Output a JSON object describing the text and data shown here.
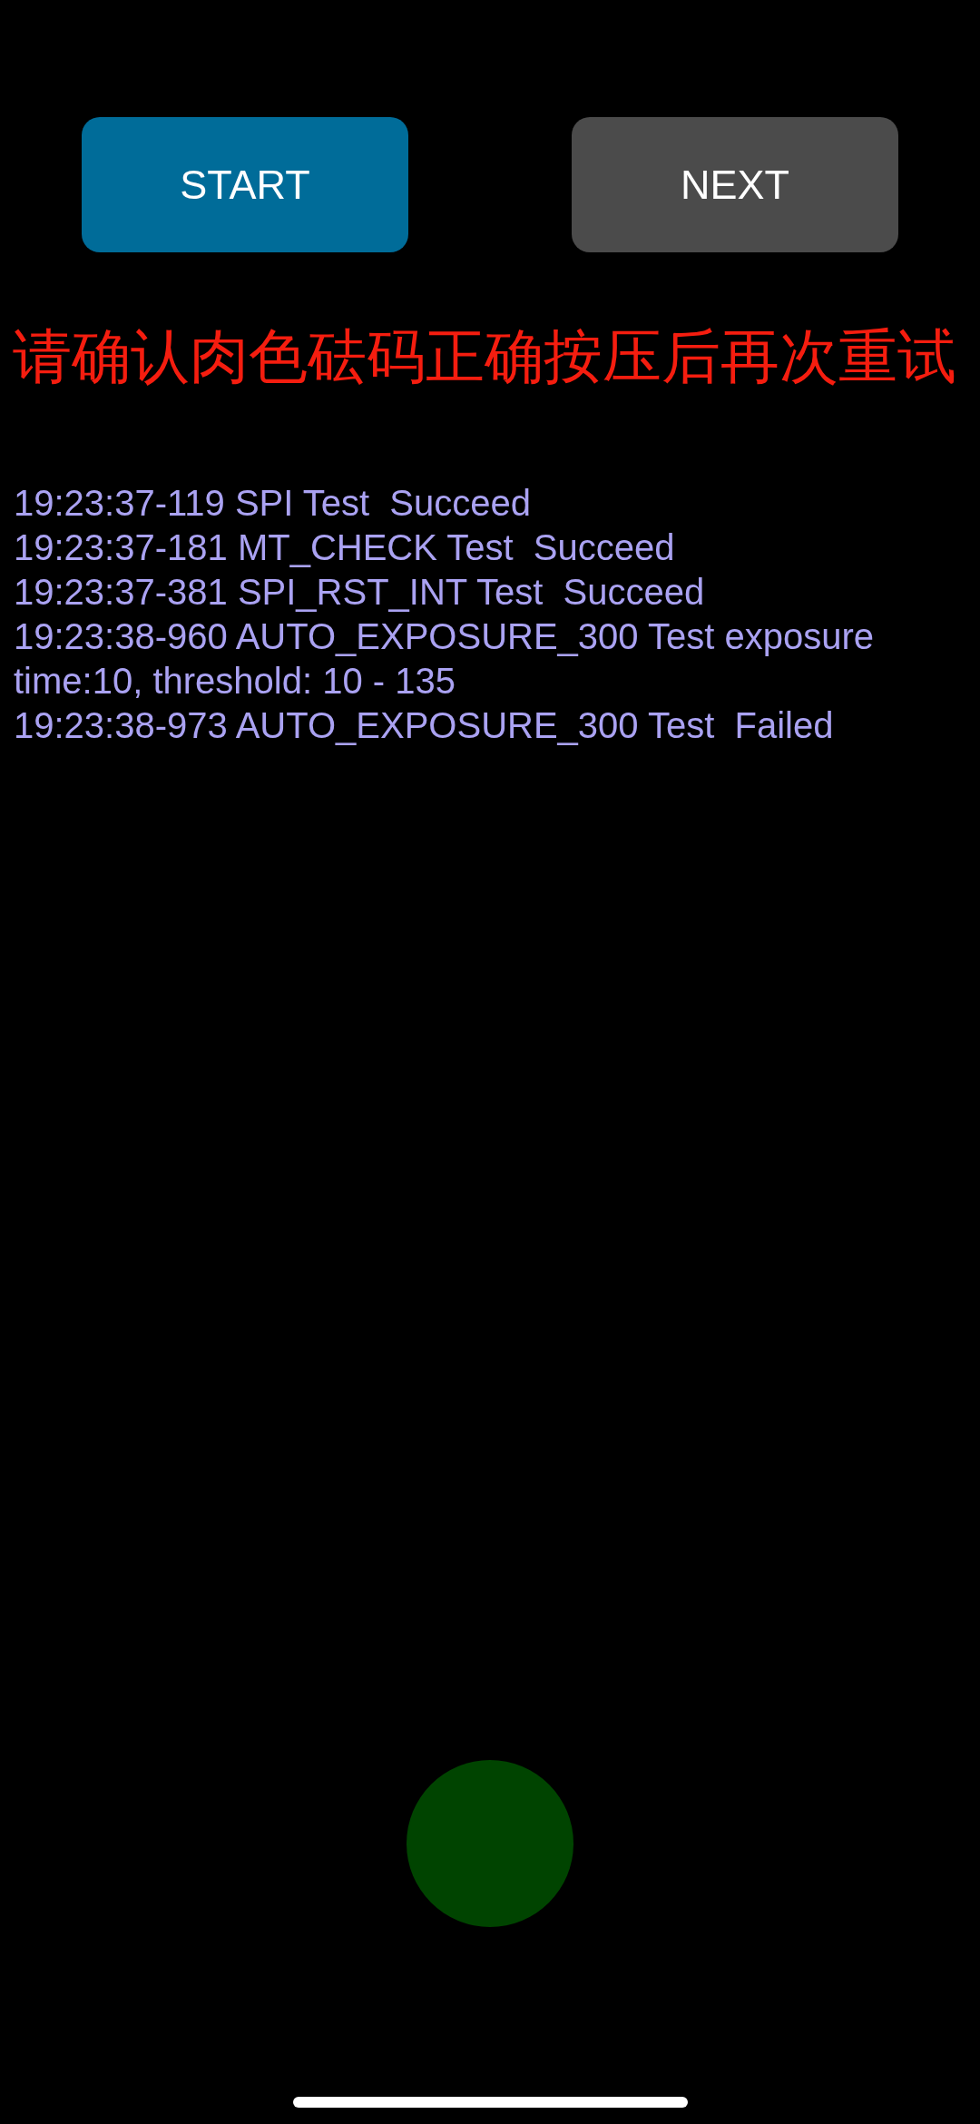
{
  "buttons": [
    {
      "label": "START",
      "color": "#006c99"
    },
    {
      "label": "NEXT",
      "color": "#4b4b4b"
    }
  ],
  "warning": "请确认肉色砝码正确按压后再次重试",
  "log": [
    "19:23:37-119 SPI Test  Succeed",
    "19:23:37-181 MT_CHECK Test  Succeed",
    "19:23:37-381 SPI_RST_INT Test  Succeed",
    "19:23:38-960 AUTO_EXPOSURE_300 Test exposure time:10, threshold: 10 - 135",
    "19:23:38-973 AUTO_EXPOSURE_300 Test  Failed"
  ]
}
